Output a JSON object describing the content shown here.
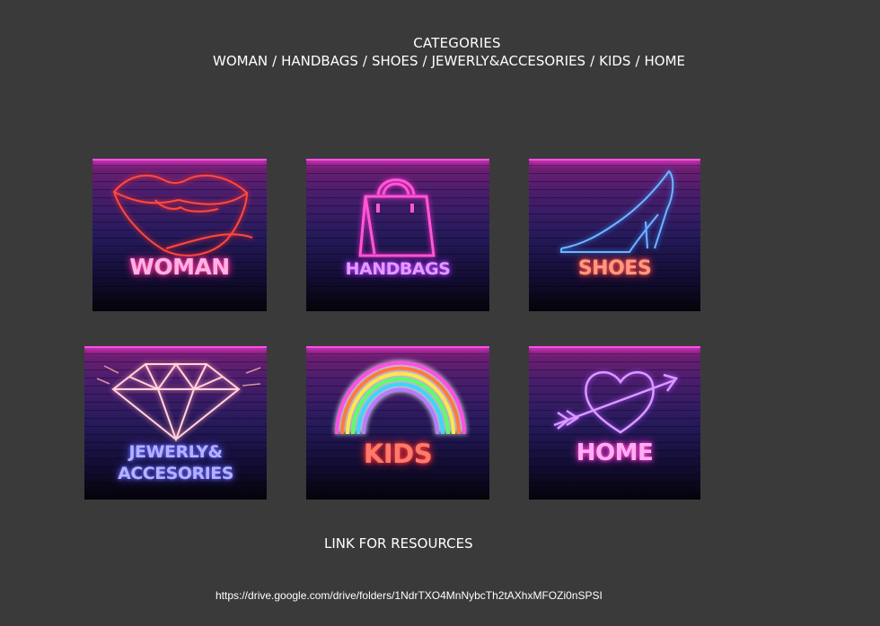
{
  "header": {
    "title": "CATEGORIES",
    "nav": [
      "WOMAN",
      "HANDBAGS",
      "SHOES",
      "JEWERLY&ACCESORIES",
      "KIDS",
      "HOME"
    ],
    "separator": "/"
  },
  "tiles": [
    {
      "label": "WOMAN",
      "icon": "lips-icon",
      "color": "#ff3aa8"
    },
    {
      "label": "HANDBAGS",
      "icon": "handbag-icon",
      "color": "#bb43ff"
    },
    {
      "label": "SHOES",
      "icon": "high-heel-icon",
      "color": "#ff4f52"
    },
    {
      "label_lines": [
        "JEWERLY&",
        "ACCESORIES"
      ],
      "icon": "diamond-icon",
      "color": "#6a6bff"
    },
    {
      "label": "KIDS",
      "icon": "rainbow-icon",
      "color": "#ff3a3a"
    },
    {
      "label": "HOME",
      "icon": "heart-arrow-icon",
      "color": "#ff4bd9"
    }
  ],
  "resources": {
    "heading": "LINK FOR RESOURCES",
    "url": "https://drive.google.com/drive/folders/1NdrTXO4MnNybcTh2tAXhxMFOZi0nSPSI"
  }
}
